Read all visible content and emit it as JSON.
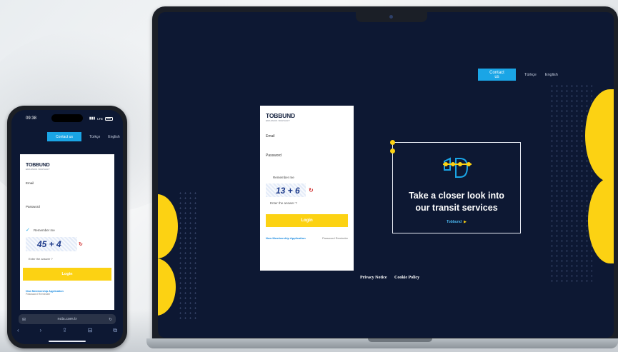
{
  "laptop": {
    "nav": {
      "contact": "Contact us",
      "lang_tr": "Türkçe",
      "lang_en": "English"
    },
    "login": {
      "logo": "TOBBUND",
      "logo_sub": "ERASMUS BURSARY",
      "email_label": "Email",
      "password_label": "Password",
      "remember": "Remember me",
      "captcha": "13 + 6",
      "answer_placeholder": "Enter the answer ?",
      "login_button": "Login",
      "new_membership": "New Membership Application",
      "password_reminder": "Password Reminder"
    },
    "promo": {
      "title_line1": "Take a closer look into",
      "title_line2": "our transit services",
      "link": "Tobbund"
    },
    "footer": {
      "privacy": "Privacy Notice",
      "cookie": "Cookie Policy"
    }
  },
  "phone": {
    "status": {
      "time": "09:38",
      "network": "LTE"
    },
    "nav": {
      "contact": "Contact us",
      "lang_tr": "Türkçe",
      "lang_en": "English"
    },
    "login": {
      "logo": "TOBBUND",
      "logo_sub": "ERASMUS BURSARY",
      "email_label": "Email",
      "password_label": "Password",
      "remember": "Remember me",
      "captcha": "45 + 4",
      "answer_placeholder": "Enter the answer ?",
      "login_button": "Login",
      "new_membership": "New Membership Application",
      "password_reminder": "Password Reminder"
    },
    "browser": {
      "url": "ncts.com.tr"
    }
  },
  "colors": {
    "navy": "#0d1833",
    "accent_yellow": "#fcd213",
    "accent_blue": "#1aa5e6"
  }
}
